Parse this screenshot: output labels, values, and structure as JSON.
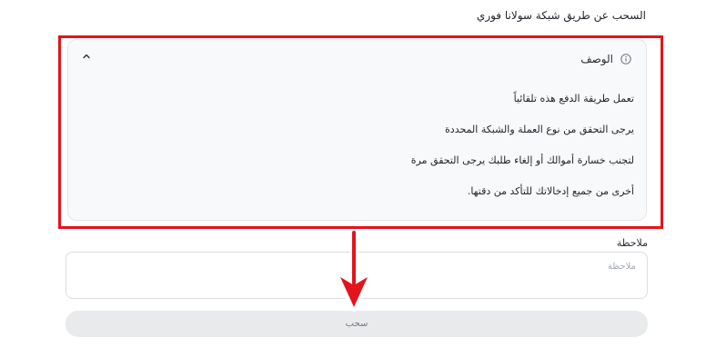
{
  "withdraw_method_title": "السحب عن طريق شبكة سولانا فوري",
  "description": {
    "label": "الوصف",
    "lines": [
      "تعمل طريقة الدفع هذه تلقائياً",
      "يرجى التحقق من نوع العملة والشبكة المحددة",
      "لتجنب خسارة أموالك أو إلغاء طلبك يرجى التحقق مرة",
      "أخرى من جميع إدخالاتك للتأكد من دقتها."
    ]
  },
  "note": {
    "label": "ملاحظة",
    "placeholder": "ملاحظة",
    "value": ""
  },
  "withdraw_button": {
    "label": "سحب"
  },
  "colors": {
    "highlight": "#e3141b",
    "button_bg": "#e9eaec"
  },
  "icons": [
    "info-icon",
    "chevron-up-icon",
    "arrow-down-annotation"
  ]
}
